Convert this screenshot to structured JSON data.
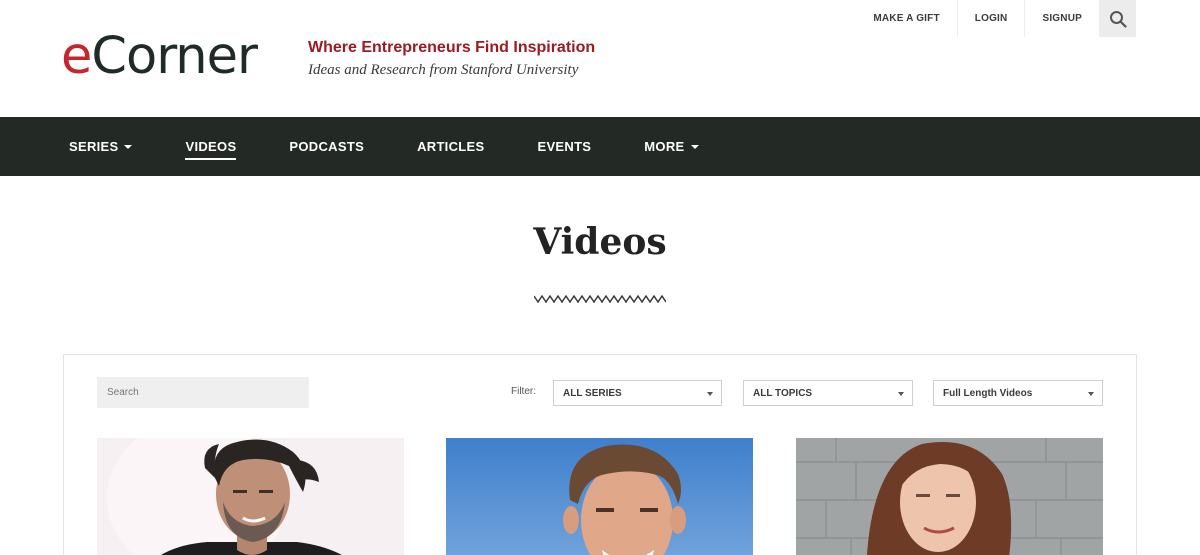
{
  "brand": {
    "logo_e": "e",
    "logo_rest": "Corner",
    "tagline_primary": "Where Entrepreneurs Find Inspiration",
    "tagline_secondary": "Ideas and Research from Stanford University"
  },
  "utility_nav": {
    "make_gift": "MAKE A GIFT",
    "login": "LOGIN",
    "signup": "SIGNUP",
    "search_icon": "search-icon"
  },
  "main_nav": {
    "items": [
      {
        "label": "SERIES",
        "dropdown": true
      },
      {
        "label": "VIDEOS",
        "active": true
      },
      {
        "label": "PODCASTS"
      },
      {
        "label": "ARTICLES"
      },
      {
        "label": "EVENTS"
      },
      {
        "label": "MORE",
        "dropdown": true
      }
    ]
  },
  "page": {
    "title": "Videos"
  },
  "filters": {
    "search_placeholder": "Search",
    "label": "Filter:",
    "series": "ALL SERIES",
    "topics": "ALL TOPICS",
    "length": "Full Length Videos"
  },
  "colors": {
    "brand_red": "#c4262e",
    "tagline_red": "#9c1b22",
    "nav_bg": "#232a26"
  }
}
